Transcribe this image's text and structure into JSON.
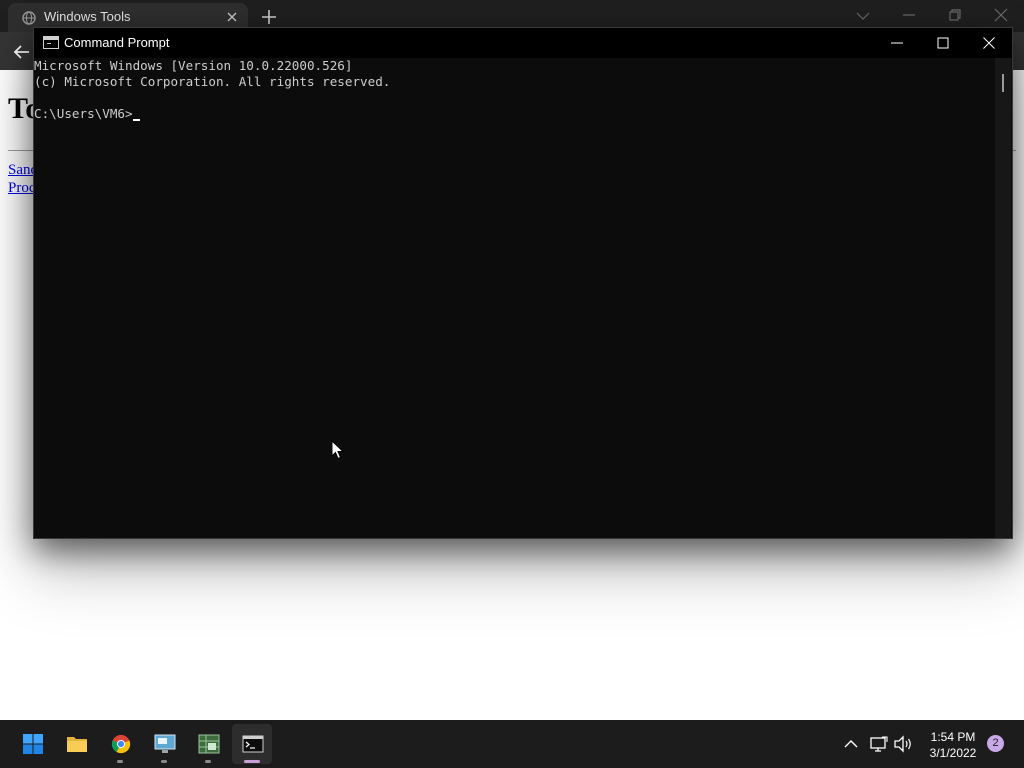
{
  "browser": {
    "tab_title": "Windows Tools",
    "page": {
      "heading": "To",
      "links": [
        "Sand",
        "Proc"
      ]
    }
  },
  "cmd": {
    "title": "Command Prompt",
    "lines": [
      "Microsoft Windows [Version 10.0.22000.526]",
      "(c) Microsoft Corporation. All rights reserved.",
      "",
      "C:\\Users\\VM6>"
    ]
  },
  "taskbar": {
    "apps": [
      {
        "name": "start",
        "icon": "windows-start-icon"
      },
      {
        "name": "file-explorer",
        "icon": "folder-icon"
      },
      {
        "name": "chrome",
        "icon": "chrome-icon"
      },
      {
        "name": "remote-desktop",
        "icon": "monitor-app-icon"
      },
      {
        "name": "spreadsheet-app",
        "icon": "spreadsheet-app-icon"
      },
      {
        "name": "command-prompt",
        "icon": "terminal-icon"
      }
    ],
    "clock": {
      "time": "1:54 PM",
      "date": "3/1/2022"
    },
    "notification_count": "2"
  },
  "colors": {
    "console_bg": "#0c0c0c",
    "console_text": "#cccccc",
    "taskbar_bg": "#1c1c1c",
    "accent": "#c9a8e8"
  }
}
